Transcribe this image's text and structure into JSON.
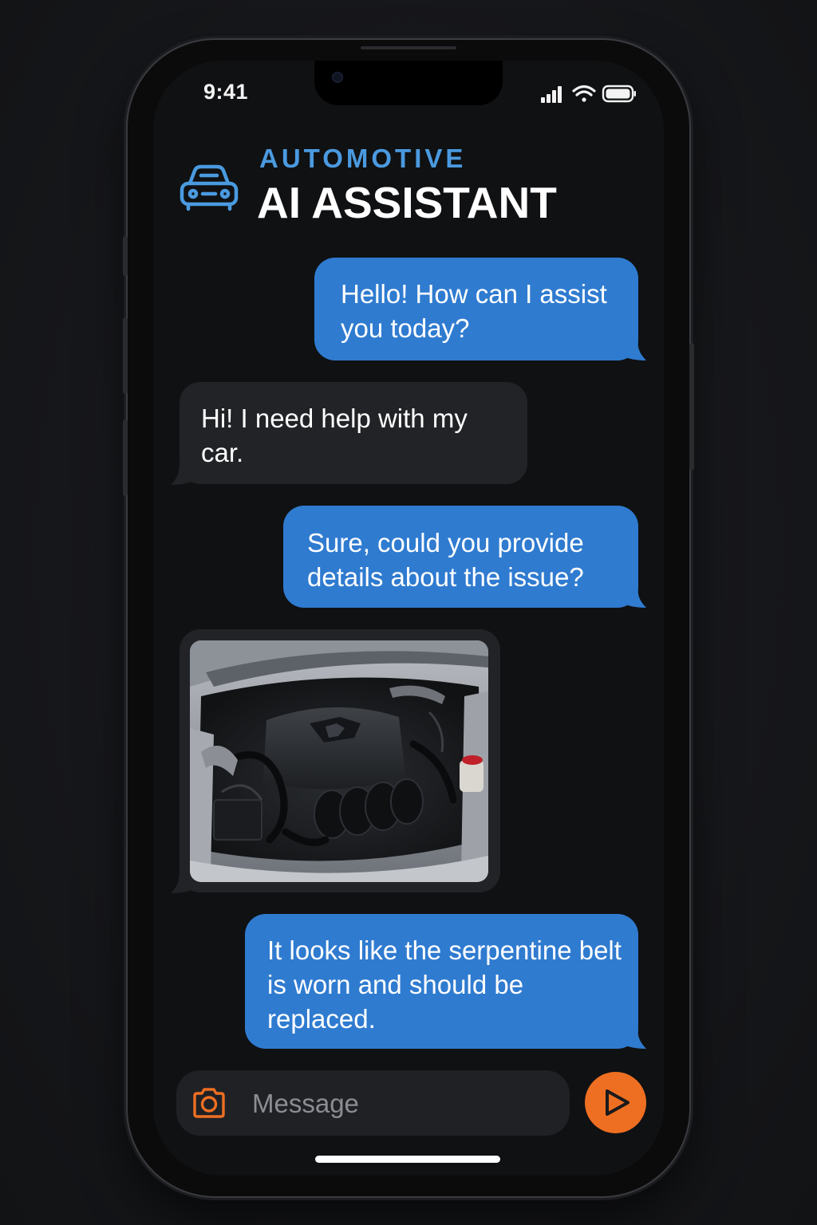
{
  "status_bar": {
    "time": "9:41",
    "icons": [
      "cellular-signal-icon",
      "wifi-icon",
      "battery-icon"
    ]
  },
  "header": {
    "icon": "car-icon",
    "kicker": "AUTOMOTIVE",
    "title": "AI ASSISTANT"
  },
  "messages": [
    {
      "sender": "assistant",
      "text": "Hello! How can I assist you today?"
    },
    {
      "sender": "user",
      "text": "Hi! I need help with my car."
    },
    {
      "sender": "assistant",
      "text": "Sure, could you provide details about the issue?"
    },
    {
      "sender": "user",
      "type": "image",
      "image": "engine-bay-photo"
    },
    {
      "sender": "assistant",
      "text": "It looks like the serpentine belt is worn and should be replaced."
    }
  ],
  "composer": {
    "placeholder": "Message",
    "camera_icon": "camera-icon",
    "send_icon": "send-icon"
  },
  "colors": {
    "accent_blue": "#2f7bd0",
    "kicker_blue": "#4a9ae0",
    "send_orange": "#ee6f22",
    "incoming_bubble": "#222327",
    "background": "#101113"
  }
}
